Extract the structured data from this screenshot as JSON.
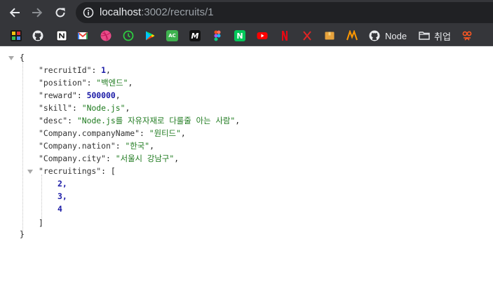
{
  "browser": {
    "url_host": "localhost",
    "url_path": ":3002/recruits/1",
    "nav": {
      "back": "back-arrow",
      "forward": "forward-arrow",
      "reload": "reload-arrow"
    }
  },
  "bookmarks": [
    {
      "name": "multicolor-grid-icon",
      "label": "",
      "color": "#1a1a1a"
    },
    {
      "name": "github-icon",
      "label": "",
      "color": "#35363a"
    },
    {
      "name": "notion-icon",
      "label": "",
      "color": "#ffffff"
    },
    {
      "name": "gmail-icon",
      "label": "",
      "color": "#ffffff"
    },
    {
      "name": "dribbble-icon",
      "label": "",
      "color": "#ea4c89"
    },
    {
      "name": "green-clock-icon",
      "label": "",
      "color": "#35363a"
    },
    {
      "name": "play-store-icon",
      "label": "",
      "color": "#35363a"
    },
    {
      "name": "ac-icon",
      "label": "AC",
      "color": "#3fb24f"
    },
    {
      "name": "m-icon",
      "label": "M",
      "color": "#111111"
    },
    {
      "name": "figma-icon",
      "label": "",
      "color": "#35363a"
    },
    {
      "name": "naver-icon",
      "label": "N",
      "color": "#03c75a"
    },
    {
      "name": "youtube-icon",
      "label": "",
      "color": "#ff0000"
    },
    {
      "name": "netflix-icon",
      "label": "",
      "color": "#35363a"
    },
    {
      "name": "red-x-icon",
      "label": "",
      "color": "#35363a"
    },
    {
      "name": "box-icon",
      "label": "",
      "color": "#e6a23c"
    },
    {
      "name": "orange-m-icon",
      "label": "",
      "color": "#35363a"
    },
    {
      "name": "github-node-icon",
      "label": "Node",
      "color": "#35363a"
    },
    {
      "name": "folder-icon",
      "label": "취업",
      "color": "#35363a"
    },
    {
      "name": "flower-icon",
      "label": "",
      "color": "#35363a"
    }
  ],
  "json": {
    "open_brace": "{",
    "close_brace": "}",
    "fields": [
      {
        "key": "\"recruitId\"",
        "value": "1",
        "type": "num",
        "comma": ","
      },
      {
        "key": "\"position\"",
        "value": "\"백엔드\"",
        "type": "str",
        "comma": ","
      },
      {
        "key": "\"reward\"",
        "value": "500000",
        "type": "num",
        "comma": ","
      },
      {
        "key": "\"skill\"",
        "value": "\"Node.js\"",
        "type": "str",
        "comma": ","
      },
      {
        "key": "\"desc\"",
        "value": "\"Node.js를 자유자재로 다룰줄 아는 사람\"",
        "type": "str",
        "comma": ","
      },
      {
        "key": "\"Company.companyName\"",
        "value": "\"원티드\"",
        "type": "str",
        "comma": ","
      },
      {
        "key": "\"Company.nation\"",
        "value": "\"한국\"",
        "type": "str",
        "comma": ","
      },
      {
        "key": "\"Company.city\"",
        "value": "\"서울시 강남구\"",
        "type": "str",
        "comma": ","
      }
    ],
    "array_key": "\"recruitings\"",
    "array_open": "[",
    "array_close": "]",
    "array_values": [
      "2,",
      "3,",
      "4"
    ]
  }
}
